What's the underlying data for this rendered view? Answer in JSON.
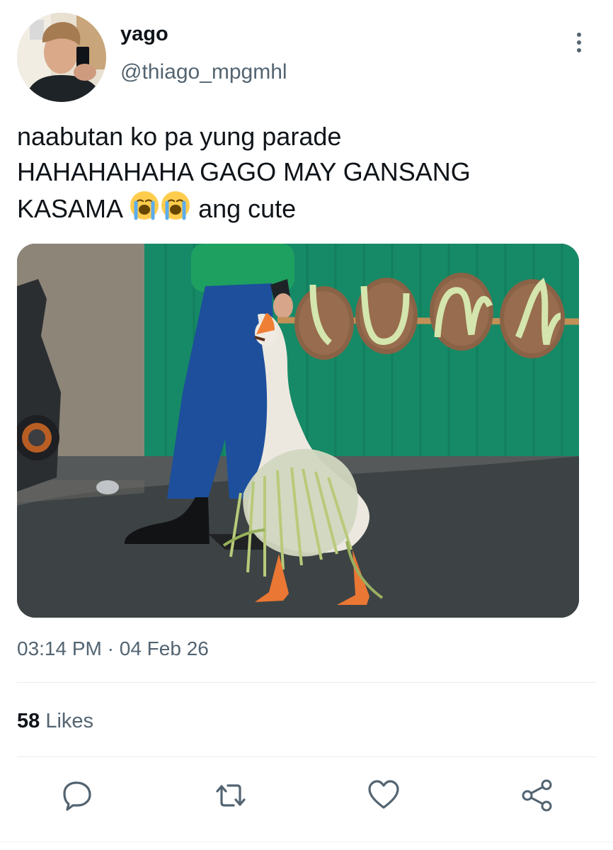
{
  "author": {
    "name": "yago",
    "handle": "@thiago_mpgmhl"
  },
  "tweet": {
    "line1": "naabutan ko pa yung parade",
    "line2": "HAHAHAHAHA GAGO MAY GANSANG",
    "line3_prefix": "KASAMA ",
    "line3_suffix": " ang cute",
    "emoji_name": "loudly-crying-face"
  },
  "meta": {
    "time": "03:14 PM",
    "separator": " · ",
    "date": "04 Feb 26"
  },
  "stats": {
    "likes_count": "58",
    "likes_label": " Likes"
  },
  "icons": {
    "more": "more-vertical-icon",
    "reply": "reply-icon",
    "retweet": "retweet-icon",
    "like": "heart-icon",
    "share": "share-icon"
  },
  "colors": {
    "text": "#0f1419",
    "secondary": "#536471",
    "divider": "#e6ecf0"
  }
}
